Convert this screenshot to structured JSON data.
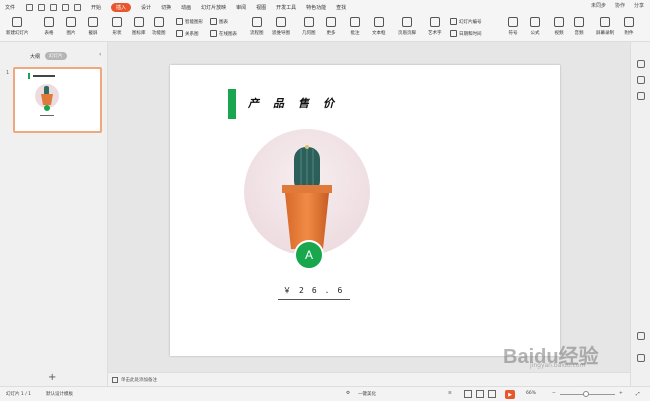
{
  "menubar": {
    "file": "文件",
    "tabs": [
      "开始",
      "插入",
      "设计",
      "切换",
      "动画",
      "幻灯片放映",
      "审阅",
      "视图",
      "开发工具",
      "特色功能",
      "查找"
    ],
    "active_tab_index": 1,
    "right": [
      "未同步",
      "协作",
      "分享"
    ]
  },
  "ribbon": {
    "groups": [
      "新建幻灯片",
      "表格",
      "图片",
      "截屏",
      "形状",
      "图标库",
      "功能图",
      "图表",
      "文本框",
      "艺术字",
      "符号",
      "公式",
      "视频",
      "音频",
      "屏幕录制",
      "附件"
    ],
    "small": [
      "智能图形",
      "流程图",
      "关系图",
      "在线图表",
      "思维导图",
      "几何图",
      "更多",
      "批注",
      "页眉页脚",
      "幻灯片编号",
      "日期和时间",
      "对象"
    ]
  },
  "leftpanel": {
    "tab_outline": "大纲",
    "tab_slides": "幻灯片",
    "slide_number": "1",
    "add_label": "+"
  },
  "slide": {
    "title": "产品售价",
    "badge": "A",
    "price": "￥26.6"
  },
  "notes": {
    "placeholder": "单击此处添加备注"
  },
  "status": {
    "slide_count": "幻灯片 1 / 1",
    "theme": "默认设计模板",
    "beautify": "一键美化",
    "zoom": "66%"
  },
  "watermark": {
    "main": "Baidu经验",
    "sub": "jingyan.baidu.com"
  },
  "colors": {
    "accent": "#e8562d",
    "green": "#1aa551",
    "thumb_border": "#f0a77e"
  }
}
